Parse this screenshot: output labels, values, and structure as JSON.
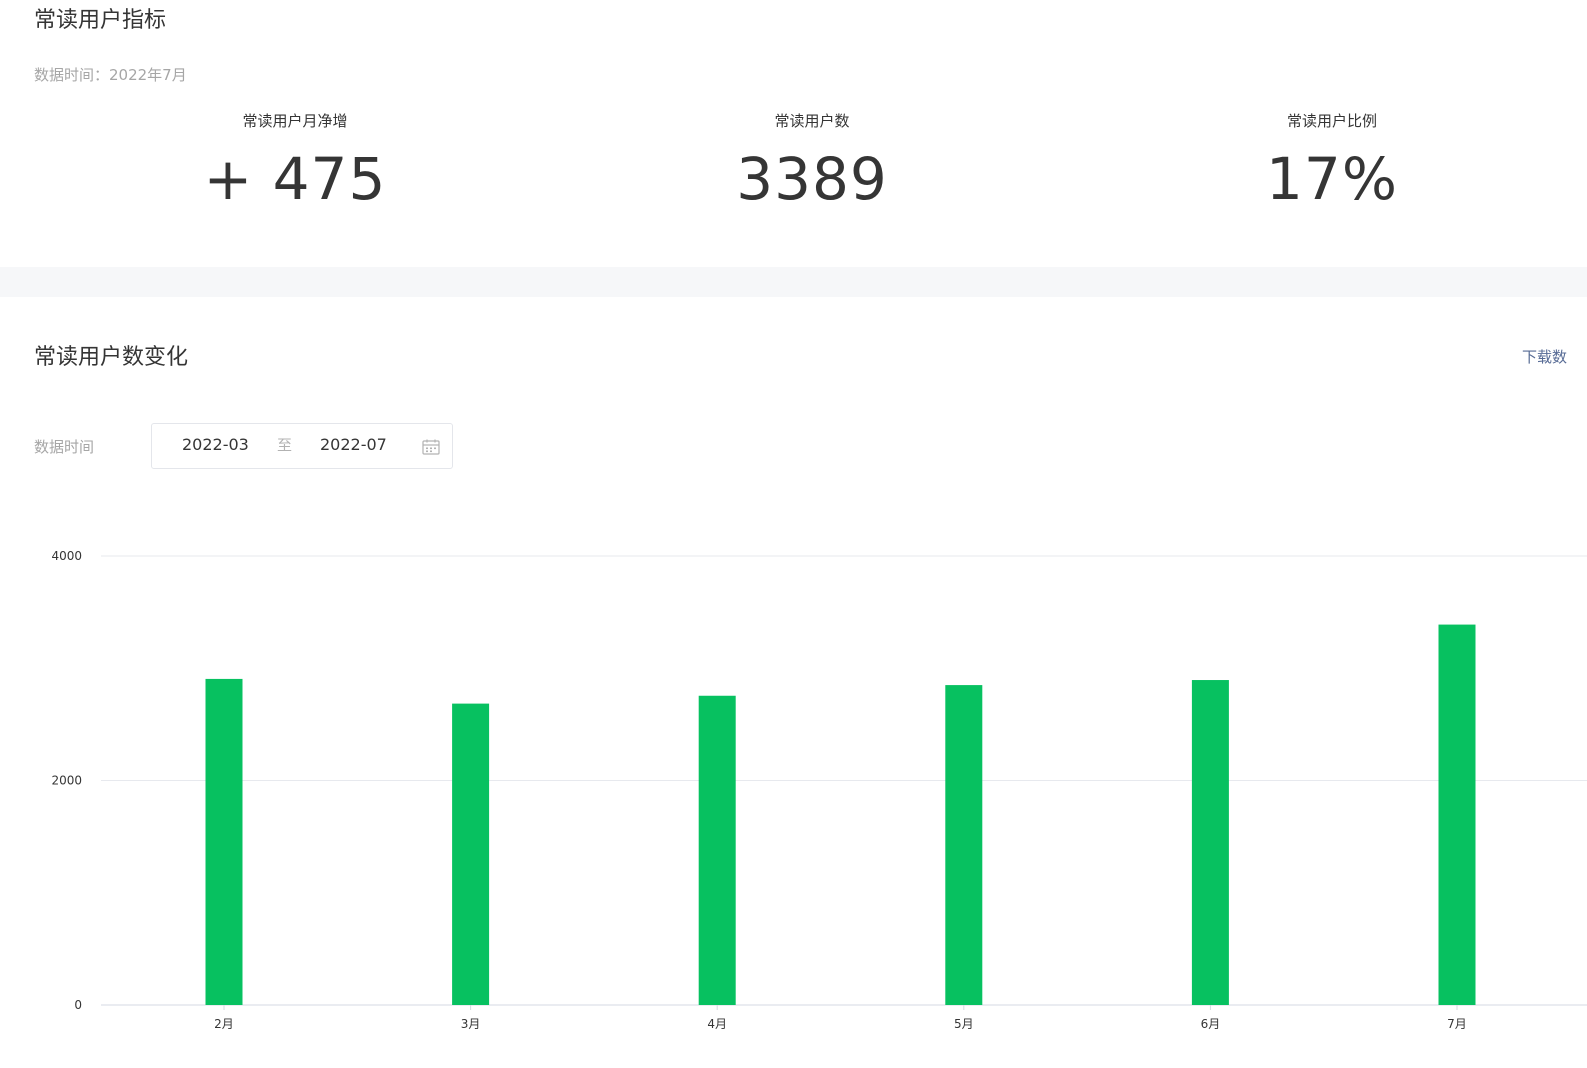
{
  "metrics_section": {
    "title": "常读用户指标",
    "data_time": "数据时间：2022年7月",
    "metrics": [
      {
        "label": "常读用户月净增",
        "value": "+ 475"
      },
      {
        "label": "常读用户数",
        "value": "3389"
      },
      {
        "label": "常读用户比例",
        "value": "17%"
      }
    ]
  },
  "trend_section": {
    "title": "常读用户数变化",
    "download_label": "下载数",
    "filter": {
      "label": "数据时间",
      "start": "2022-03",
      "separator": "至",
      "end": "2022-07",
      "icon": "calendar-icon"
    }
  },
  "colors": {
    "bar": "#07c160",
    "grid": "#e7e9ee",
    "link": "#576b95",
    "band": "#f6f7f9"
  },
  "chart_data": {
    "type": "bar",
    "categories": [
      "2月",
      "3月",
      "4月",
      "5月",
      "6月",
      "7月"
    ],
    "values": [
      2905,
      2685,
      2755,
      2850,
      2895,
      3389
    ],
    "ylim": [
      0,
      4000
    ],
    "yticks": [
      "0",
      "2000",
      "4000"
    ],
    "grid": true,
    "legend": "none"
  }
}
